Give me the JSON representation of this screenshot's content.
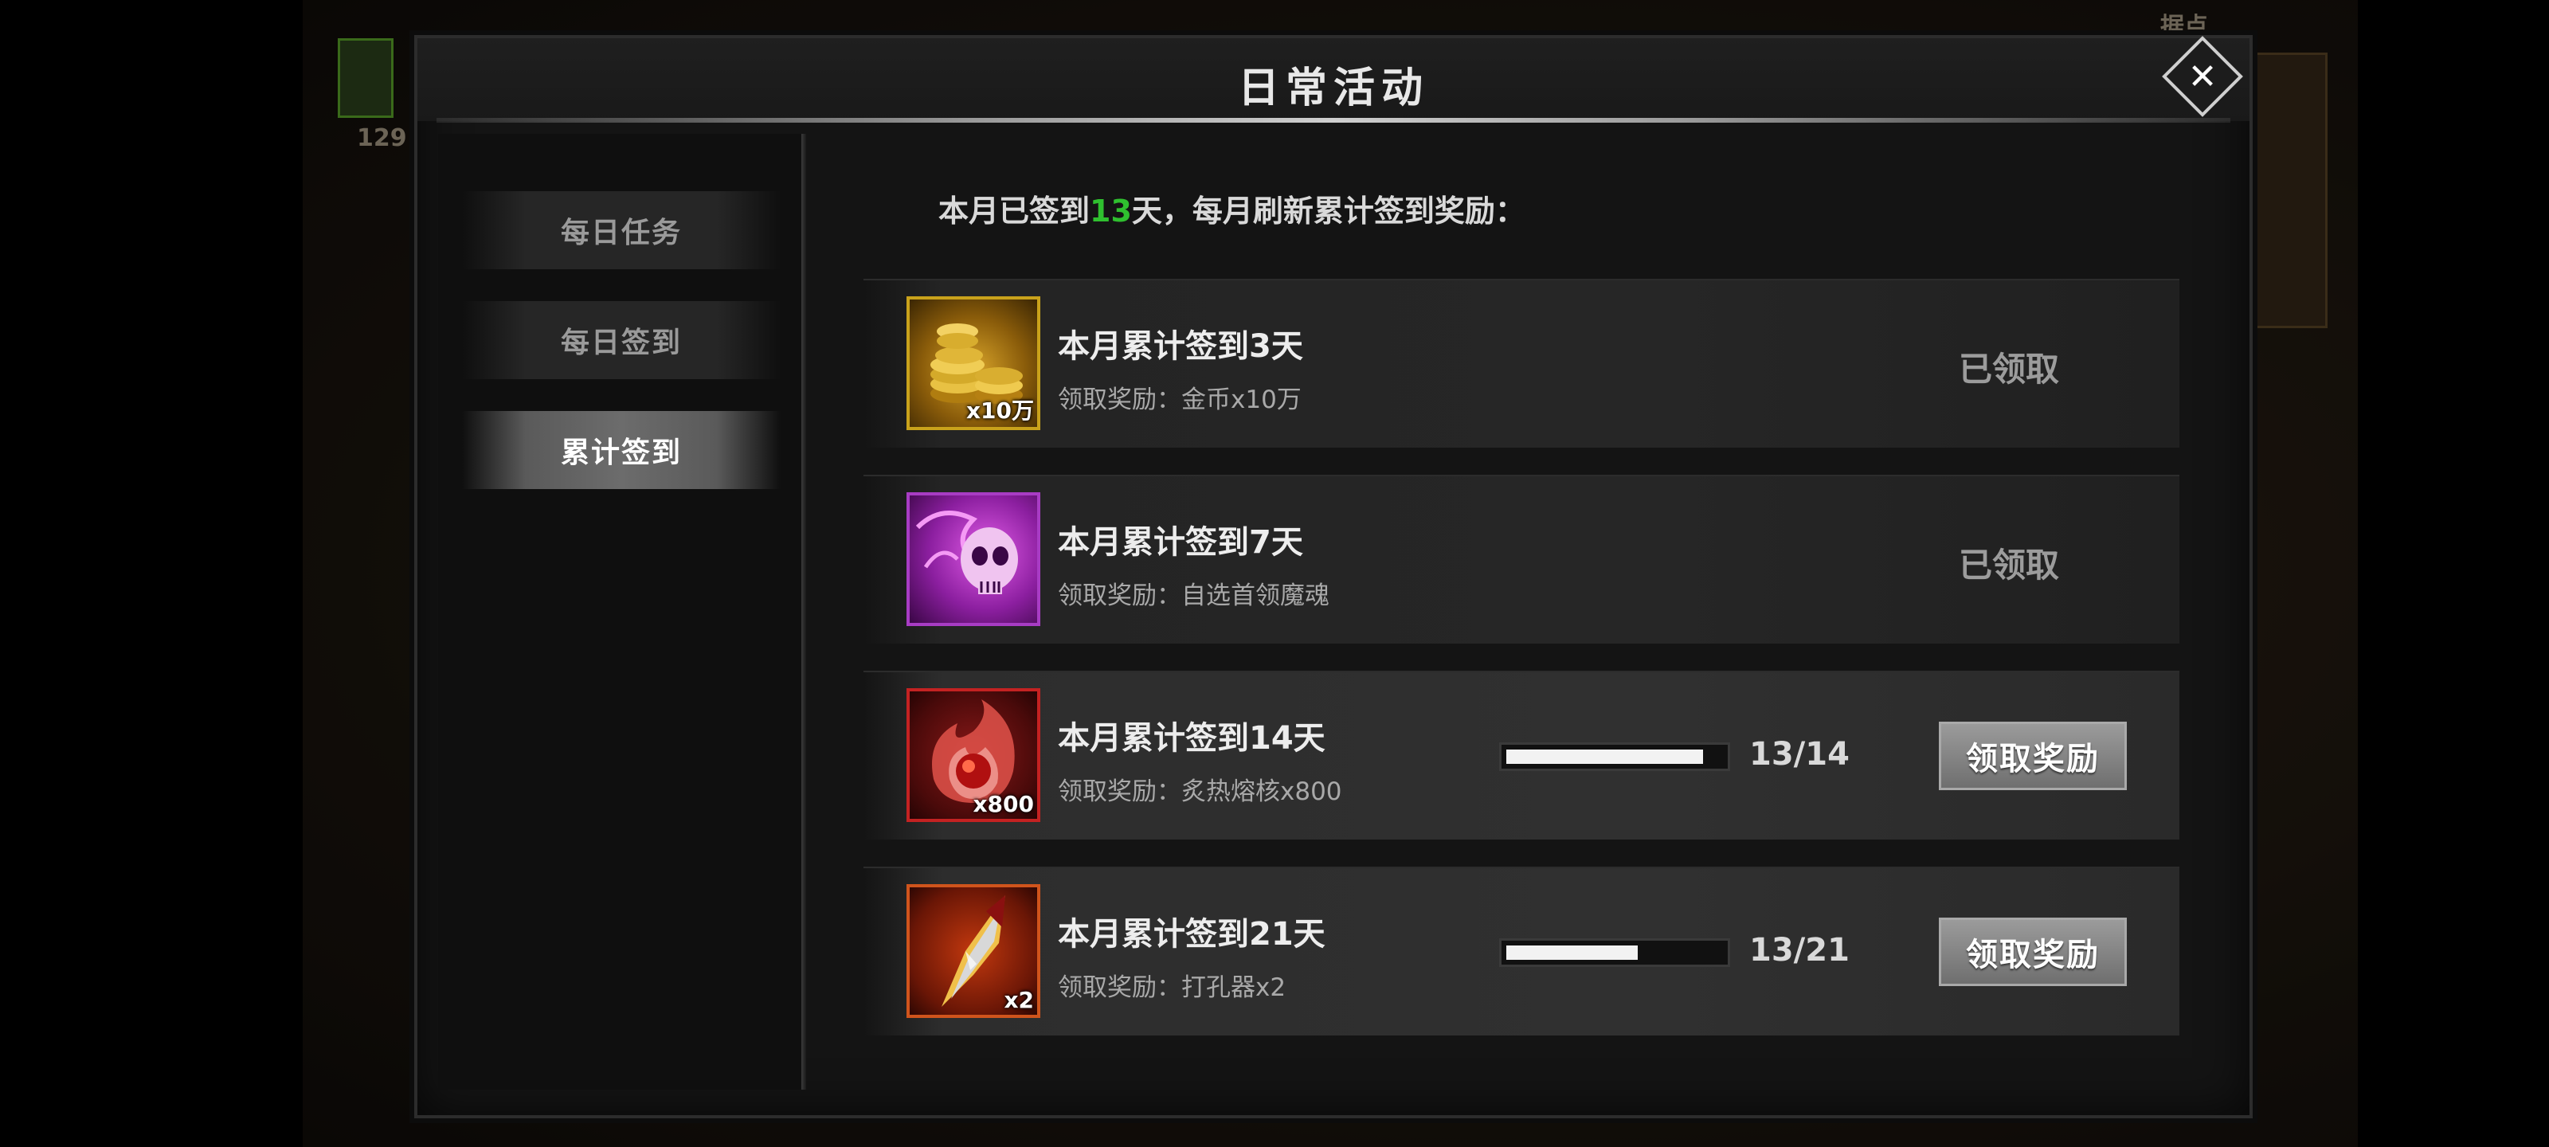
{
  "background": {
    "top_label": "据点",
    "left_count": "129"
  },
  "dialog": {
    "title": "日常活动",
    "close_icon": "✕"
  },
  "sidebar": {
    "tabs": [
      {
        "label": "每日任务",
        "active": false
      },
      {
        "label": "每日签到",
        "active": false
      },
      {
        "label": "累计签到",
        "active": true
      }
    ]
  },
  "header": {
    "prefix": "本月已签到",
    "days": "13",
    "suffix": "天，每月刷新累计签到奖励："
  },
  "rewards": [
    {
      "title": "本月累计签到3天",
      "desc": "领取奖励：金币x10万",
      "qty": "x10万",
      "icon": "gold-coins-icon",
      "status": "已领取"
    },
    {
      "title": "本月累计签到7天",
      "desc": "领取奖励：自选首领魔魂",
      "qty": "",
      "icon": "purple-skull-icon",
      "status": "已领取"
    },
    {
      "title": "本月累计签到14天",
      "desc": "领取奖励：炙热熔核x800",
      "qty": "x800",
      "icon": "molten-core-icon",
      "progress_text": "13/14",
      "progress": 0.9286,
      "button": "领取奖励"
    },
    {
      "title": "本月累计签到21天",
      "desc": "领取奖励：打孔器x2",
      "qty": "x2",
      "icon": "puncher-icon",
      "progress_text": "13/21",
      "progress": 0.619,
      "button": "领取奖励"
    }
  ],
  "colors": {
    "highlight_green": "#2fc02f",
    "gold_frame": "#c9a21b",
    "purple_frame": "#a83cc4",
    "red_frame": "#c42222",
    "orange_frame": "#d0541c"
  }
}
